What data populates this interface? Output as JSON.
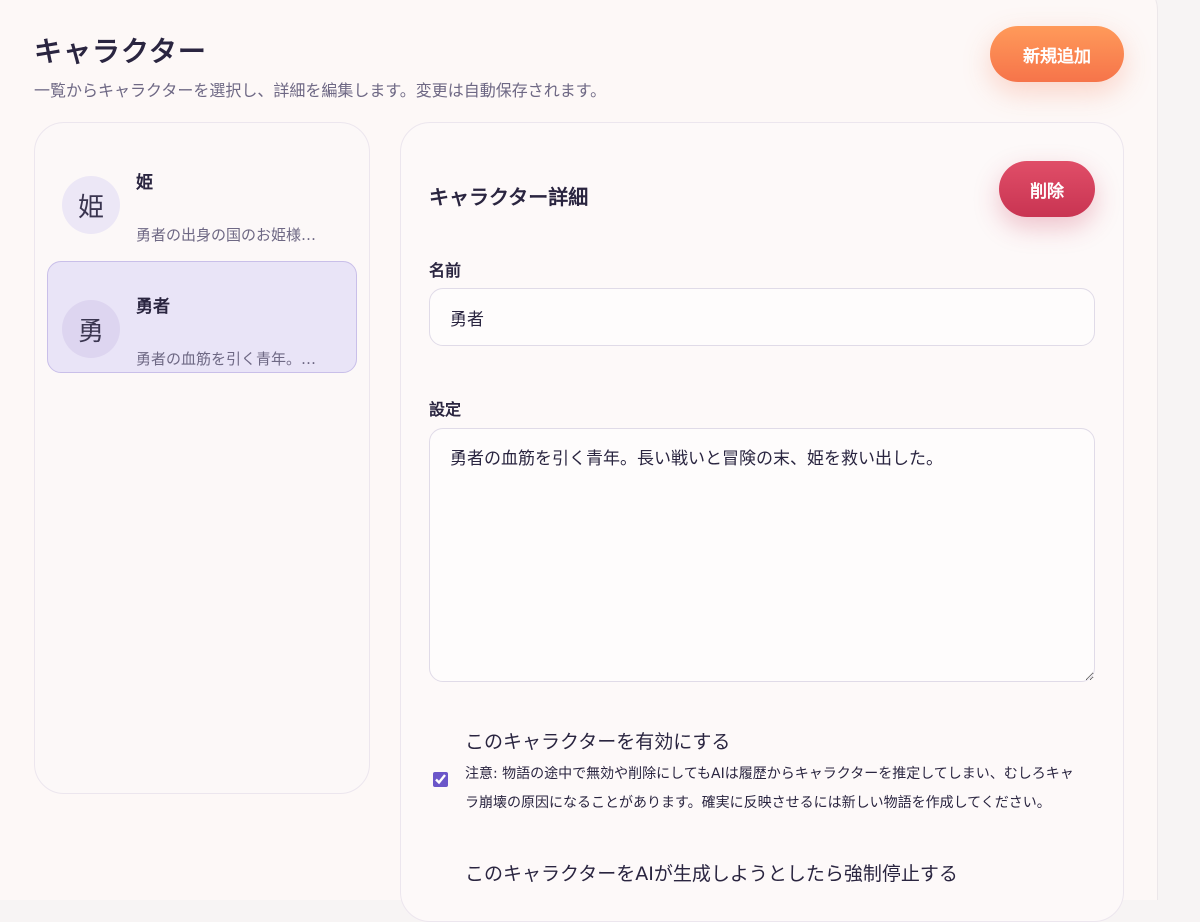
{
  "header": {
    "title": "キャラクター",
    "subtitle": "一覧からキャラクターを選択し、詳細を編集します。変更は自動保存されます。",
    "add_button": "新規追加"
  },
  "characters": [
    {
      "avatar": "姫",
      "name": "姫",
      "desc": "勇者の出身の国のお姫様…"
    },
    {
      "avatar": "勇",
      "name": "勇者",
      "desc": "勇者の血筋を引く青年。…"
    }
  ],
  "detail": {
    "title": "キャラクター詳細",
    "delete_button": "削除",
    "name_label": "名前",
    "name_value": "勇者",
    "setting_label": "設定",
    "setting_value": "勇者の血筋を引く青年。長い戦いと冒険の末、姫を救い出した。",
    "enable_label": "このキャラクターを有効にする",
    "enable_checked": true,
    "enable_note": "注意: 物語の途中で無効や削除にしてもAIは履歴からキャラクターを推定してしまい、むしろキャラ崩壊の原因になることがあります。確実に反映させるには新しい物語を作成してください。",
    "force_stop_label": "このキャラクターをAIが生成しようとしたら強制停止する"
  }
}
